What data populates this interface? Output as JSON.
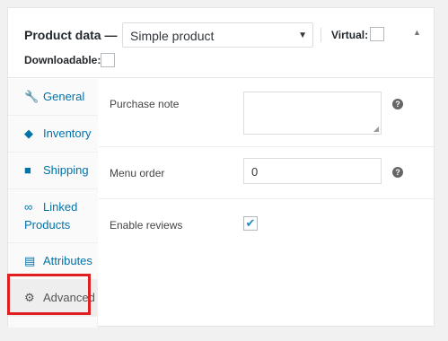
{
  "header": {
    "title": "Product data —",
    "product_type": "Simple product",
    "virtual_label": "Virtual:",
    "downloadable_label": "Downloadable:",
    "collapse_icon": "triangle-up-icon"
  },
  "tabs": [
    {
      "label": "General",
      "icon": "wrench-icon"
    },
    {
      "label": "Inventory",
      "icon": "tag-icon"
    },
    {
      "label": "Shipping",
      "icon": "truck-icon"
    },
    {
      "label": "Linked",
      "label2": "Products",
      "icon": "link-icon"
    },
    {
      "label": "Attributes",
      "icon": "list-icon"
    },
    {
      "label": "Advanced",
      "icon": "gear-icon",
      "active": true
    }
  ],
  "fields": {
    "purchase_note_label": "Purchase note",
    "purchase_note_value": "",
    "menu_order_label": "Menu order",
    "menu_order_value": "0",
    "enable_reviews_label": "Enable reviews",
    "enable_reviews_checked": true
  },
  "help_icon": "?"
}
